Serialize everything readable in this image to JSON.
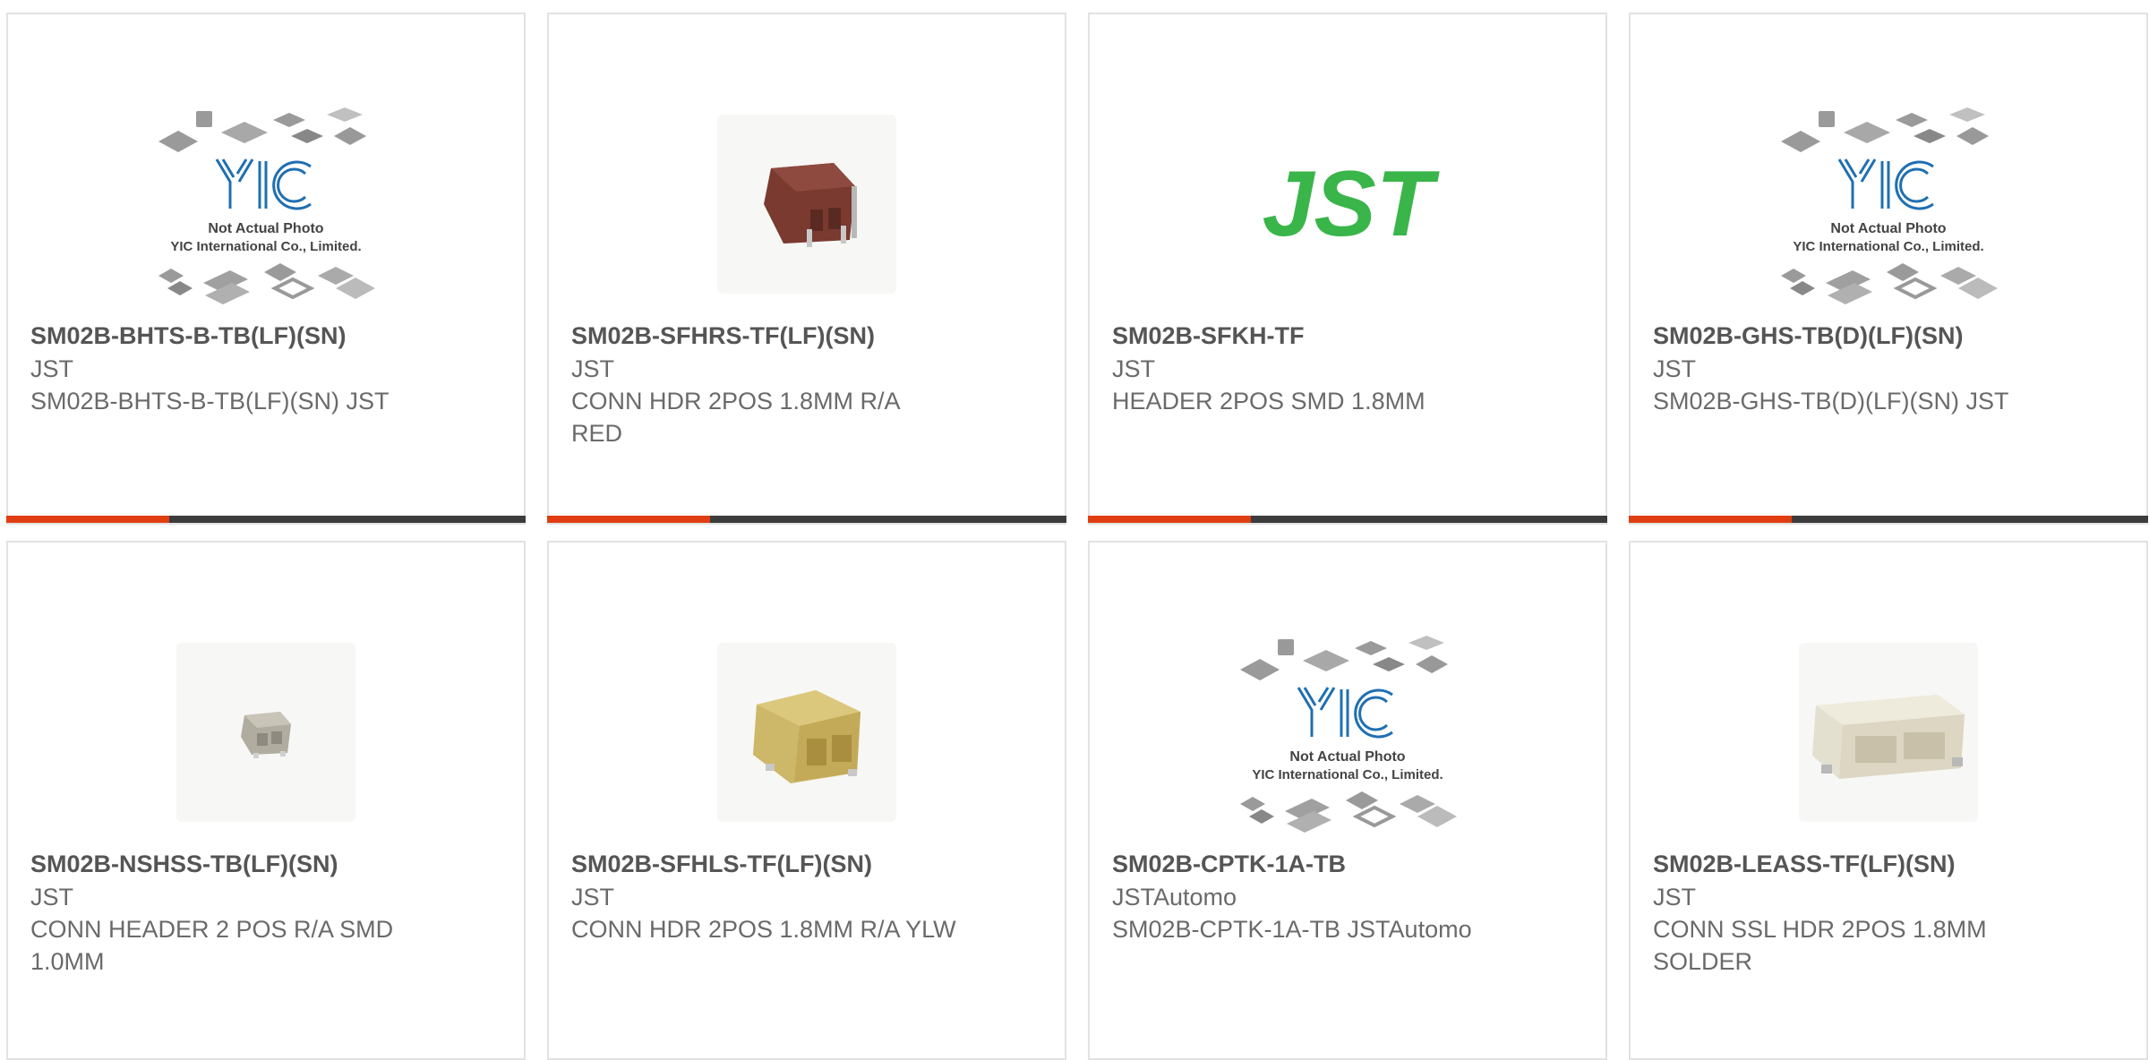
{
  "colors": {
    "accent": "#e03e12",
    "bar": "#3c3c3c",
    "jst_green": "#3ab54a",
    "yic_blue": "#1f6fb2"
  },
  "placeholder": {
    "line1": "Not Actual Photo",
    "line2": "YIC International Co., Limited."
  },
  "cards": [
    {
      "part_number": "SM02B-BHTS-B-TB(LF)(SN)",
      "manufacturer": "JST",
      "description": "SM02B-BHTS-B-TB(LF)(SN) JST",
      "image": "placeholder",
      "selected": true
    },
    {
      "part_number": "SM02B-SFHRS-TF(LF)(SN)",
      "manufacturer": "JST",
      "description": "CONN HDR 2POS 1.8MM R/A RED",
      "image": "red-connector-photo",
      "selected": true
    },
    {
      "part_number": "SM02B-SFKH-TF",
      "manufacturer": "JST",
      "description": "HEADER 2POS SMD 1.8MM",
      "image": "jst-logo",
      "logo_text": "JST",
      "selected": true
    },
    {
      "part_number": "SM02B-GHS-TB(D)(LF)(SN)",
      "manufacturer": "JST",
      "description": "SM02B-GHS-TB(D)(LF)(SN) JST",
      "image": "placeholder",
      "selected": true
    },
    {
      "part_number": "SM02B-NSHSS-TB(LF)(SN)",
      "manufacturer": "JST",
      "description": "CONN HEADER 2 POS R/A SMD 1.0MM",
      "image": "small-gray-connector-photo",
      "selected": false
    },
    {
      "part_number": "SM02B-SFHLS-TF(LF)(SN)",
      "manufacturer": "JST",
      "description": "CONN HDR 2POS 1.8MM R/A YLW",
      "image": "yellow-connector-photo",
      "selected": false
    },
    {
      "part_number": "SM02B-CPTK-1A-TB",
      "manufacturer": "JSTAutomo",
      "description": "SM02B-CPTK-1A-TB JSTAutomo",
      "image": "placeholder",
      "selected": false
    },
    {
      "part_number": "SM02B-LEASS-TF(LF)(SN)",
      "manufacturer": "JST",
      "description": "CONN SSL HDR 2POS 1.8MM SOLDER",
      "image": "white-connector-photo",
      "selected": false
    }
  ]
}
